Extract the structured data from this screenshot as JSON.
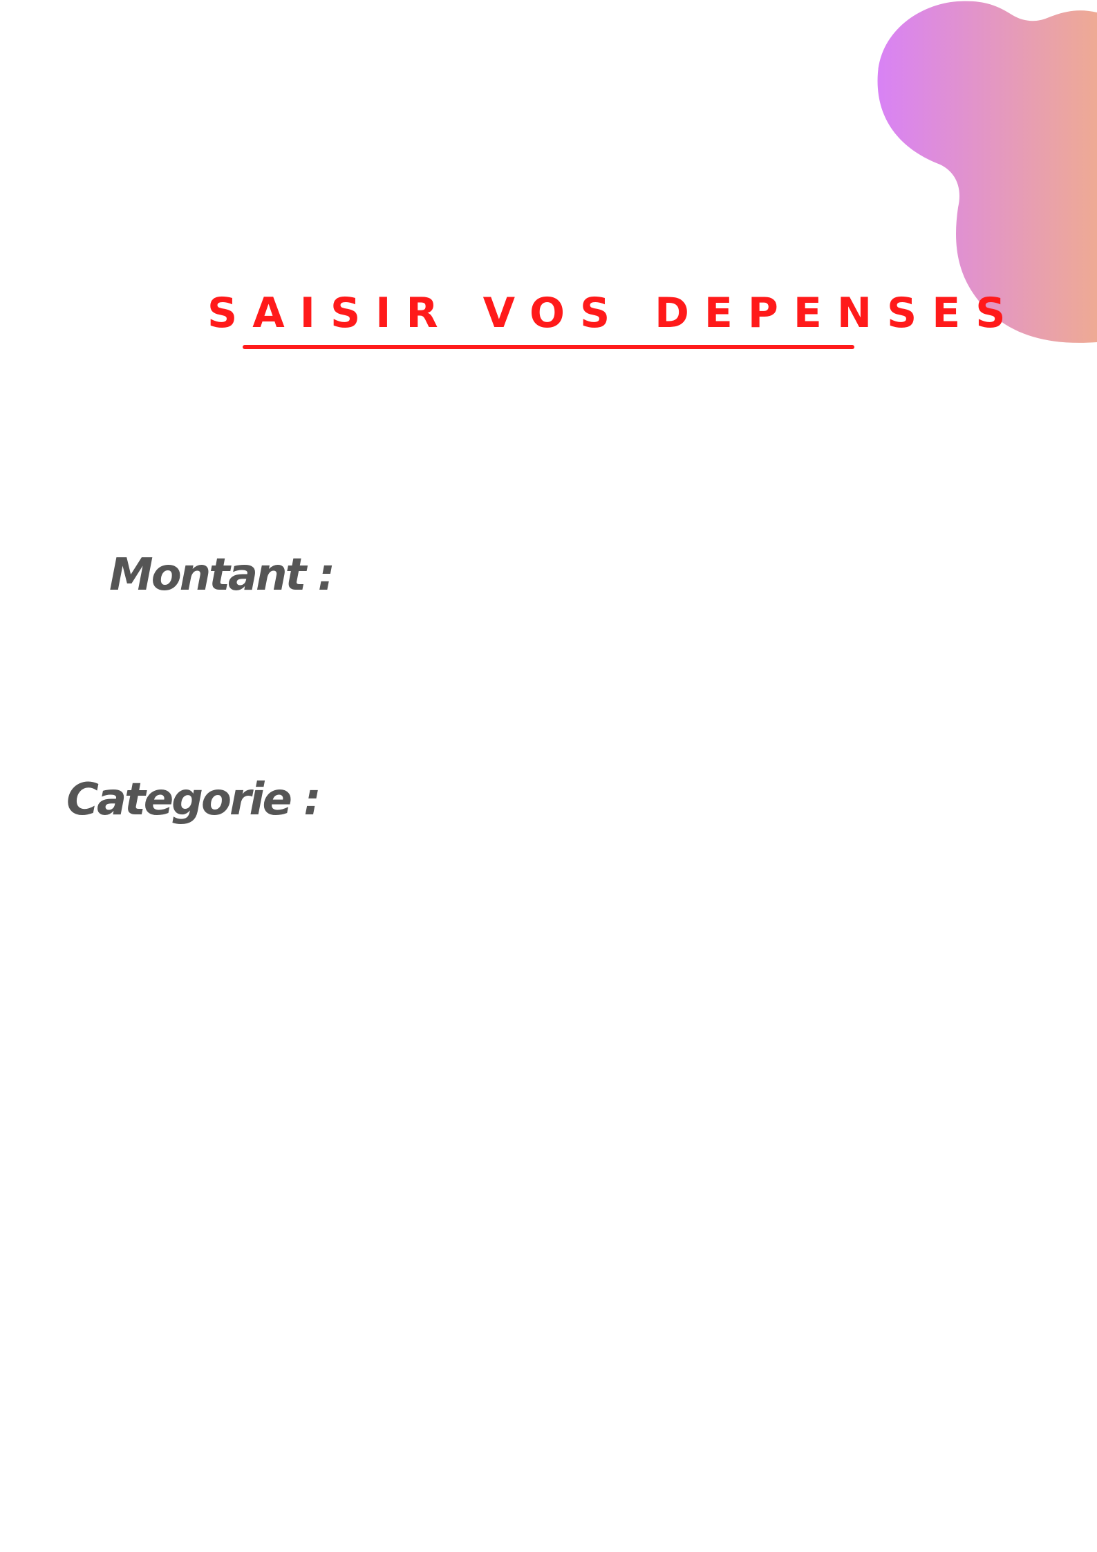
{
  "page": {
    "title": "SAISIR VOS DEPENSES",
    "fields": {
      "montant_label": "Montant :",
      "categorie_label": "Categorie :"
    }
  },
  "colors": {
    "title": "#ff1a1a",
    "label": "#555555",
    "blob_gradient_start": "#d882f5",
    "blob_gradient_end": "#eeaa94"
  },
  "icons": {
    "decoration": "gradient-blob-shape"
  }
}
